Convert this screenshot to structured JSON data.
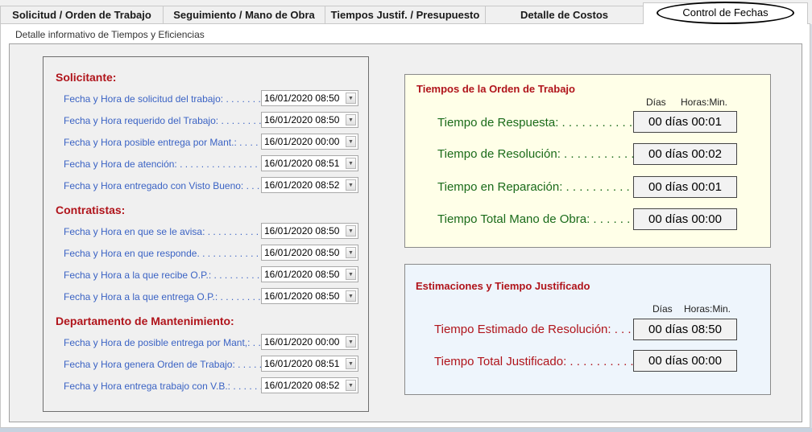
{
  "tabs": [
    {
      "label": "Solicitud / Orden de Trabajo"
    },
    {
      "label": "Seguimiento / Mano de Obra"
    },
    {
      "label": "Tiempos Justif. / Presupuesto"
    },
    {
      "label": "Detalle de Costos"
    },
    {
      "label": "Control de Fechas"
    }
  ],
  "subtitle": "Detalle informativo de Tiempos y Eficiencias",
  "solicitante": {
    "title": "Solicitante:",
    "rows": [
      {
        "label": "Fecha y Hora de solicitud del trabajo: . . . . . . . . .",
        "value": "16/01/2020 08:50"
      },
      {
        "label": "Fecha y Hora requerido del Trabajo: . . . . . . . . . . . .",
        "value": "16/01/2020 08:50"
      },
      {
        "label": "Fecha y Hora posible entrega por Mant.: . . . . . . . .",
        "value": "16/01/2020 00:00"
      },
      {
        "label": "Fecha y Hora de atención: . . . . . . . . . . . . . . . . . . . .",
        "value": "16/01/2020 08:51"
      },
      {
        "label": "Fecha y Hora entregado con Visto Bueno: . . . . . . . .",
        "value": "16/01/2020 08:52"
      }
    ]
  },
  "contratistas": {
    "title": "Contratistas:",
    "rows": [
      {
        "label": "Fecha y Hora en que se le avisa: . . . . . . . . . . . . . . .",
        "value": "16/01/2020 08:50"
      },
      {
        "label": "Fecha y Hora en que responde. . . . . . . . . . . . . . . . . .",
        "value": "16/01/2020 08:50"
      },
      {
        "label": "Fecha y Hora a la que recibe O.P.: . . . . . . . . . . . . .",
        "value": "16/01/2020 08:50"
      },
      {
        "label": "Fecha y Hora a la que entrega O.P.: . . . . . . . . . . . .",
        "value": "16/01/2020 08:50"
      }
    ]
  },
  "mantenimiento": {
    "title": "Departamento de Mantenimiento:",
    "rows": [
      {
        "label": "Fecha y Hora de posible entrega por Mant,: . . . . . .",
        "value": "16/01/2020 00:00"
      },
      {
        "label": "Fecha y Hora genera Orden de Trabajo: . . . . . . . . . .",
        "value": "16/01/2020 08:51"
      },
      {
        "label": "Fecha y Hora entrega trabajo con V.B.: . . . . . . . . . .",
        "value": "16/01/2020 08:52"
      }
    ]
  },
  "tiempos": {
    "title": "Tiempos de la Orden de Trabajo",
    "col_dias": "Días",
    "col_horas": "Horas:Min.",
    "rows": [
      {
        "label": "Tiempo de Respuesta: . . . . . . . . . . . . .",
        "value": "00 días 00:01"
      },
      {
        "label": "Tiempo de Resolución: . . . . . . . . . . . .",
        "value": "00 días 00:02"
      },
      {
        "label": "Tiempo en Reparación: . . . . . . . . . . . .",
        "value": "00 días 00:01"
      },
      {
        "label": "Tiempo Total Mano de Obra: . . . . . . .",
        "value": "00 días 00:00"
      }
    ]
  },
  "estimaciones": {
    "title": "Estimaciones y Tiempo Justificado",
    "col_dias": "Días",
    "col_horas": "Horas:Min.",
    "rows": [
      {
        "label": "Tiempo Estimado de Resolución: . . .",
        "value": "00 días 08:50"
      },
      {
        "label": "Tiempo Total Justificado: . . . . . . . . . . .",
        "value": "00 días 00:00"
      }
    ]
  }
}
